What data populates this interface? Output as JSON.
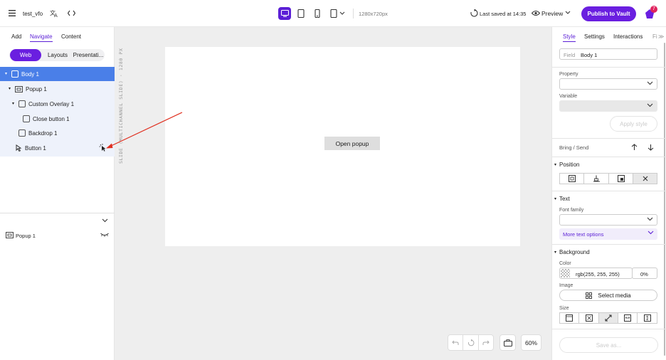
{
  "topbar": {
    "project_name": "test_vfo",
    "resolution": "1280x720px",
    "last_saved": "Last saved at 14:35",
    "preview_label": "Preview",
    "publish_label": "Publish to Vault",
    "notification_count": "7",
    "accent_color": "#6a1fe0"
  },
  "left_panel": {
    "tabs": [
      "Add",
      "Navigate",
      "Content"
    ],
    "active_tab": "Navigate",
    "segments": [
      "Web",
      "Layouts",
      "Presentati..."
    ],
    "tree": [
      {
        "label": "Body 1",
        "selected": true
      },
      {
        "label": "Popup 1"
      },
      {
        "label": "Custom Overlay 1"
      },
      {
        "label": "Close button 1"
      },
      {
        "label": "Backdrop 1"
      },
      {
        "label": "Button 1"
      }
    ],
    "popup_list_item": "Popup 1"
  },
  "canvas": {
    "slide_label": "SLIDE (MULTICHANNEL SLIDE) · 1280 PX",
    "open_popup_label": "Open popup",
    "zoom": "60%"
  },
  "right_panel": {
    "tabs": [
      "Style",
      "Settings",
      "Interactions",
      "Fi"
    ],
    "active_tab": "Style",
    "field_label": "Field",
    "field_value": "Body 1",
    "property_label": "Property",
    "variable_label": "Variable",
    "apply_style_label": "Apply style",
    "bring_send_label": "Bring / Send",
    "position_section": "Position",
    "text_section": "Text",
    "font_family_label": "Font family",
    "more_text_options": "More text options",
    "background_section": "Background",
    "color_label": "Color",
    "color_value": "rgb(255, 255, 255)",
    "opacity_value": "0%",
    "image_label": "Image",
    "select_media_label": "Select media",
    "size_label": "Size",
    "save_as_label": "Save as..."
  }
}
